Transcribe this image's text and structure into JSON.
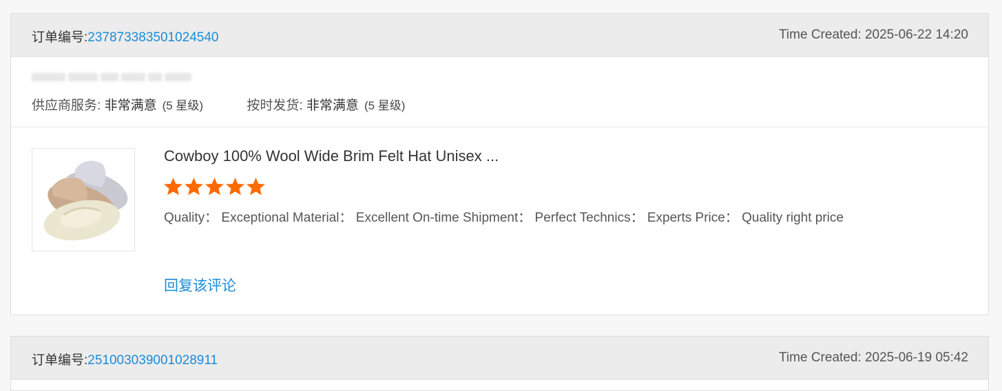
{
  "orders": [
    {
      "order_label": "订单编号:",
      "order_number": "237873383501024540",
      "time_created": "Time Created: 2025-06-22 14:20",
      "supplier_service_label": "供应商服务:",
      "supplier_service_value": "非常满意",
      "supplier_service_stars": "(5 星级)",
      "on_time_label": "按时发货:",
      "on_time_value": "非常满意",
      "on_time_stars": "(5 星级)",
      "product_title": "Cowboy 100% Wool Wide Brim Felt Hat Unisex ...",
      "product_image_alt": "cowboy-hats-product-image",
      "rating": 5,
      "star_color": "#ff6a00",
      "review_tags": "Quality： Exceptional Material： Excellent On-time Shipment： Perfect Technics： Experts Price： Quality right price",
      "reply_link": "回复该评论"
    },
    {
      "order_label": "订单编号:",
      "order_number": "251003039001028911",
      "time_created": "Time Created: 2025-06-19 05:42"
    }
  ],
  "colors": {
    "link": "#1a8cd8",
    "header_bg": "#ececec",
    "star": "#ff6a00"
  }
}
